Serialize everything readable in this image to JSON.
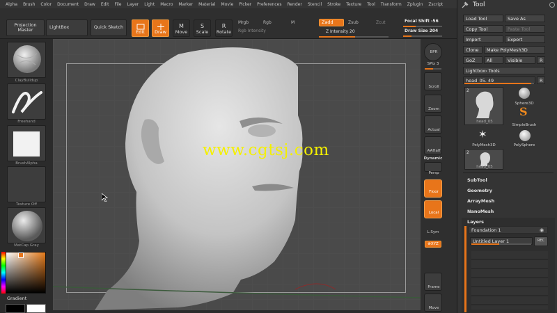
{
  "menu": [
    "Alpha",
    "Brush",
    "Color",
    "Document",
    "Draw",
    "Edit",
    "File",
    "Layer",
    "Light",
    "Macro",
    "Marker",
    "Material",
    "Movie",
    "Picker",
    "Preferences",
    "Render",
    "Stencil",
    "Stroke",
    "Texture",
    "Tool",
    "Transform",
    "Zplugin",
    "Zscript"
  ],
  "top": {
    "projection_master": "Projection Master",
    "lightbox": "LightBox",
    "quick_sketch": "Quick Sketch",
    "edit": "Edit",
    "draw": "Draw",
    "move": "Move",
    "scale": "Scale",
    "rotate": "Rotate",
    "mrgb": "Mrgb",
    "rgb": "Rgb",
    "m": "M",
    "rgb_intensity": "Rgb Intensity",
    "zadd": "Zadd",
    "zsub": "Zsub",
    "zcut": "Zcut",
    "z_intensity": "Z Intensity 20",
    "focal_shift": "Focal Shift -56",
    "draw_size": "Draw Size 204"
  },
  "left": {
    "brush": "ClayBuildup",
    "stroke": "Freehand",
    "alpha": "BrushAlpha",
    "texture": "Texture Off",
    "material": "MatCap Gray",
    "gradient": "Gradient"
  },
  "watermark": "www.cgtsj.com",
  "right": {
    "bpr": "BPR",
    "spix": "SPix 3",
    "scroll": "Scroll",
    "zoom": "Zoom",
    "actual": "Actual",
    "aahalf": "AAHalf",
    "dynamic": "Dynamic",
    "persp": "Persp",
    "floor": "Floor",
    "local": "Local",
    "lsym": "L.Sym",
    "xyz": "⊗XYZ",
    "frame": "Frame",
    "move": "Move"
  },
  "tool": {
    "title": "Tool",
    "load_tool": "Load Tool",
    "save_as": "Save As",
    "copy_tool": "Copy Tool",
    "paste_tool": "Paste Tool",
    "import": "Import",
    "export": "Export",
    "clone": "Clone",
    "make_polymesh": "Make PolyMesh3D",
    "goz": "GoZ",
    "all": "All",
    "visible": "Visible",
    "r": "R",
    "lightbox_tools": "Lightbox› Tools",
    "current_tool": "head_05. 49",
    "thumbs": [
      {
        "label": "head_05"
      },
      {
        "label": "Sphere3D"
      },
      {
        "label": "SimpleBrush"
      },
      {
        "label": "PolyMesh3D"
      },
      {
        "label": "PolySphere"
      },
      {
        "label": "head_05"
      }
    ],
    "badge1": "2",
    "badge2": "2",
    "subtool": "SubTool",
    "geometry": "Geometry",
    "arraymesh": "ArrayMesh",
    "nanomesh": "NanoMesh",
    "layers": "Layers",
    "foundation": "Foundation 1",
    "untitled_layer": "Untitled Layer 1",
    "rec": "REC"
  }
}
